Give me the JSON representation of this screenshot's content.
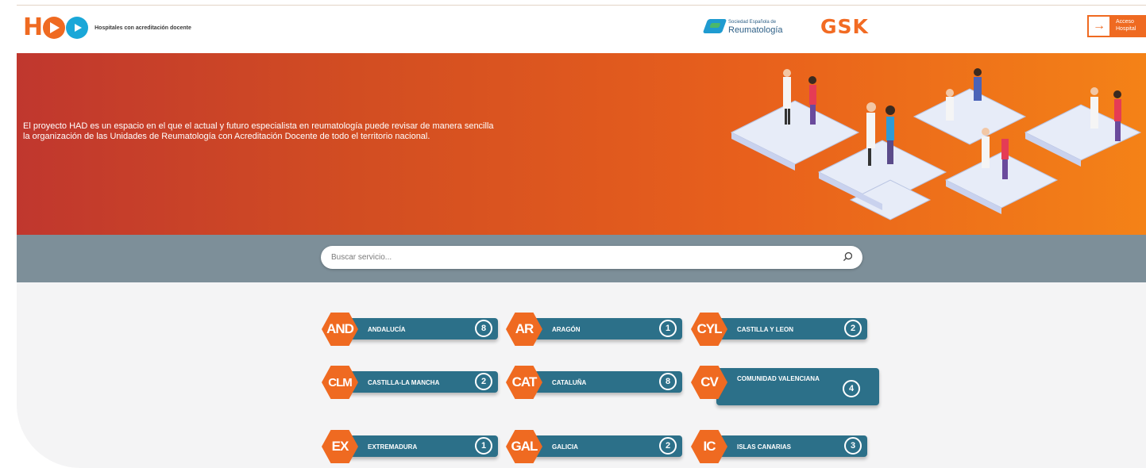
{
  "header": {
    "logo_text": "HAD",
    "logo_tagline": "Hospitales con acreditación docente",
    "partner_small": "Sociedad Española de",
    "partner_big": "Reumatología",
    "sponsor": "GSK",
    "access_label": "Acceso Hospital"
  },
  "hero": {
    "text": "El proyecto HAD es un espacio en el que el actual y futuro especialista en reumatología puede revisar de manera sencilla la organización de las Unidades de Reumatología con Acreditación Docente de todo el territorio nacional."
  },
  "search": {
    "placeholder": "Buscar servicio..."
  },
  "regions": [
    {
      "code": "AND",
      "name": "ANDALUCÍA",
      "count": "8"
    },
    {
      "code": "AR",
      "name": "ARAGÓN",
      "count": "1"
    },
    {
      "code": "CYL",
      "name": "CASTILLA Y LEON",
      "count": "2"
    },
    {
      "code": "CLM",
      "name": "CASTILLA-LA MANCHA",
      "count": "2"
    },
    {
      "code": "CAT",
      "name": "CATALUÑA",
      "count": "8"
    },
    {
      "code": "CV",
      "name": "COMUNIDAD VALENCIANA",
      "count": "4"
    },
    {
      "code": "EX",
      "name": "EXTREMADURA",
      "count": "1"
    },
    {
      "code": "GAL",
      "name": "GALICIA",
      "count": "2"
    },
    {
      "code": "IC",
      "name": "ISLAS CANARIAS",
      "count": "3"
    }
  ],
  "colors": {
    "brand_orange": "#ef6a21",
    "region_bar": "#2c7089",
    "search_band": "#7d8f99"
  }
}
